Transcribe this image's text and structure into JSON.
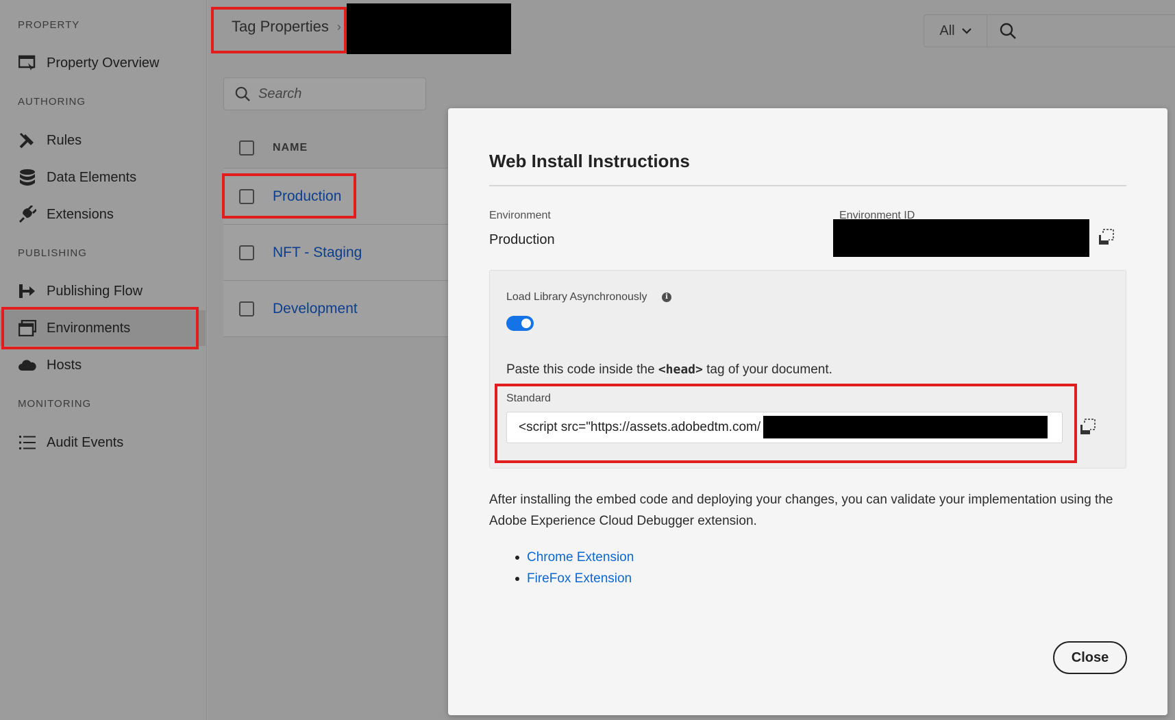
{
  "sidebar": {
    "sections": {
      "property": "PROPERTY",
      "authoring": "AUTHORING",
      "publishing": "PUBLISHING",
      "monitoring": "MONITORING"
    },
    "items": {
      "property_overview": "Property Overview",
      "rules": "Rules",
      "data_elements": "Data Elements",
      "extensions": "Extensions",
      "publishing_flow": "Publishing Flow",
      "environments": "Environments",
      "hosts": "Hosts",
      "audit_events": "Audit Events"
    },
    "active_item": "Environments"
  },
  "header": {
    "breadcrumb_root": "Tag Properties",
    "filter_value": "All"
  },
  "list": {
    "search_placeholder": "Search",
    "column_name": "NAME",
    "rows": [
      "Production",
      "NFT - Staging",
      "Development"
    ]
  },
  "modal": {
    "title": "Web Install Instructions",
    "environment_label": "Environment",
    "environment_value": "Production",
    "environment_id_label": "Environment ID",
    "load_async_label": "Load Library Asynchronously",
    "load_async_enabled": true,
    "paste_prefix": "Paste this code inside the ",
    "paste_tag": "<head>",
    "paste_suffix": " tag of your document.",
    "standard_label": "Standard",
    "code_visible": "<script src=\"https://assets.adobedtm.com/",
    "body_text": "After installing the embed code and deploying your changes, you can validate your implementation using the Adobe Experience Cloud Debugger extension.",
    "links": [
      "Chrome Extension",
      "FireFox Extension"
    ],
    "close_label": "Close"
  },
  "colors": {
    "accent_blue": "#1473e6",
    "link_blue": "#0d66d0",
    "highlight_red": "#e11d1d"
  }
}
